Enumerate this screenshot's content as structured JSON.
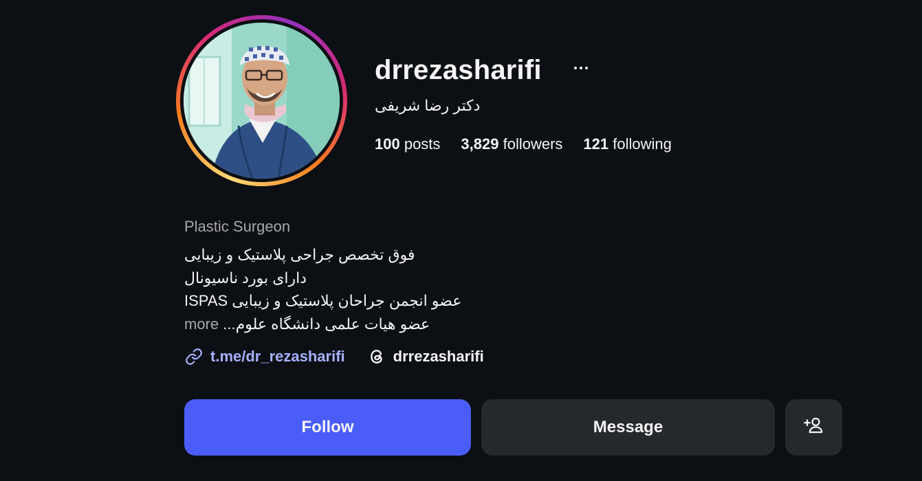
{
  "profile": {
    "username": "drrezasharifi",
    "full_name": "دکتر رضا شریفی",
    "avatar_alt": "drrezasharifi profile picture"
  },
  "stats": {
    "posts_count": "100",
    "posts_label": " posts",
    "followers_count": "3,829",
    "followers_label": " followers",
    "following_count": "121",
    "following_label": " following"
  },
  "bio": {
    "category": "Plastic Surgeon",
    "lines": [
      "فوق تخصص جراحی پلاستیک و زیبایی",
      "دارای بورد ناسیونال",
      "عضو انجمن جراحان پلاستیک و زیبایی ISPAS",
      "عضو هیات علمی دانشگاه علوم..."
    ],
    "more_label": "more"
  },
  "links": {
    "url": "t.me/dr_rezasharifi",
    "threads": "drrezasharifi"
  },
  "actions": {
    "follow_label": "Follow",
    "message_label": "Message"
  },
  "colors": {
    "background": "#0c0f14",
    "follow_button": "#4a5df9",
    "secondary_button": "#25292e",
    "link": "#a6b2ff",
    "muted_text": "#a8a8a8"
  },
  "icons": {
    "more": "more-horizontal-icon",
    "link": "link-icon",
    "threads": "threads-icon",
    "suggest": "person-add-icon"
  }
}
